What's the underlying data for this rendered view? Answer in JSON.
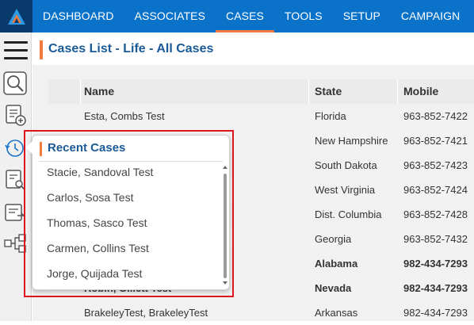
{
  "nav": {
    "items": [
      "DASHBOARD",
      "ASSOCIATES",
      "CASES",
      "TOOLS",
      "SETUP",
      "CAMPAIGN"
    ],
    "active": "CASES"
  },
  "page": {
    "title": "Cases List - Life - All Cases"
  },
  "table": {
    "columns": [
      "Name",
      "State",
      "Mobile"
    ],
    "rows": [
      {
        "name": "Esta, Combs Test",
        "state": "Florida",
        "mobile": "963-852-7422"
      },
      {
        "name": "",
        "state": "New Hampshire",
        "mobile": "963-852-7421"
      },
      {
        "name": "",
        "state": "South Dakota",
        "mobile": "963-852-7423"
      },
      {
        "name": "",
        "state": "West Virginia",
        "mobile": "963-852-7424"
      },
      {
        "name": "",
        "state": "Dist. Columbia",
        "mobile": "963-852-7428"
      },
      {
        "name": "",
        "state": "Georgia",
        "mobile": "963-852-7432"
      },
      {
        "name": "",
        "state": "Alabama",
        "mobile": "982-434-7293"
      },
      {
        "name": "Robin, Gillett Test",
        "state": "Nevada",
        "mobile": "982-434-7293"
      },
      {
        "name": "BrakeleyTest, BrakeleyTest",
        "state": "Arkansas",
        "mobile": "982-434-7293"
      }
    ]
  },
  "recent_cases": {
    "title": "Recent Cases",
    "items": [
      "Stacie, Sandoval Test",
      "Carlos, Sosa Test",
      "Thomas, Sasco Test",
      "Carmen, Collins Test",
      "Jorge, Quijada Test"
    ]
  },
  "icons": {
    "rail": [
      "menu-icon",
      "search-icon",
      "add-case-icon",
      "history-icon",
      "case-search-icon",
      "transfer-icon",
      "workflow-icon"
    ]
  },
  "colors": {
    "nav_bg": "#0a73c9",
    "accent": "#f07b3f",
    "title": "#1a5a96",
    "highlight": "#e0141e"
  }
}
